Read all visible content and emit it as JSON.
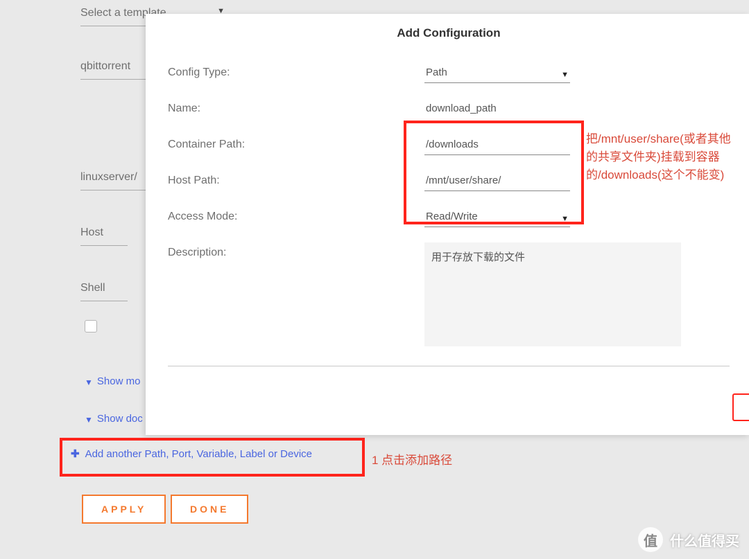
{
  "bg": {
    "template": {
      "label": "Select a template"
    },
    "name_value": "qbittorrent",
    "repo_value": "linuxserver/",
    "network": {
      "label": "Host"
    },
    "console": {
      "label": "Shell"
    },
    "show_more": "Show mo",
    "show_docker": "Show doc",
    "add_another": "Add another Path, Port, Variable, Label or Device",
    "apply": "APPLY",
    "done": "DONE"
  },
  "modal": {
    "title": "Add Configuration",
    "labels": {
      "config_type": "Config Type:",
      "name": "Name:",
      "container_path": "Container Path:",
      "host_path": "Host Path:",
      "access_mode": "Access Mode:",
      "description": "Description:"
    },
    "values": {
      "config_type": "Path",
      "name": "download_path",
      "container_path": "/downloads",
      "host_path": "/mnt/user/share/",
      "access_mode": "Read/Write",
      "description": "用于存放下载的文件"
    }
  },
  "annotations": {
    "right": "把/mnt/user/share(或者其他的共享文件夹)挂载到容器的/downloads(这个不能变)",
    "add": "1 点击添加路径"
  },
  "watermark": {
    "badge": "值",
    "text": "什么值得买"
  }
}
